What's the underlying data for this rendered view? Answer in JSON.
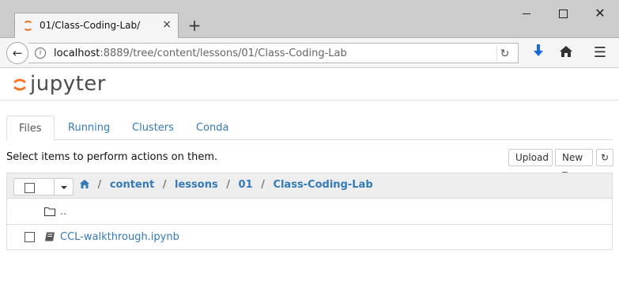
{
  "browser": {
    "tab_title": "01/Class-Coding-Lab/",
    "tab_close": "×",
    "new_tab": "+",
    "url_host": "localhost",
    "url_rest": ":8889/tree/content/lessons/01/Class-Coding-Lab",
    "icons": [
      "info-icon",
      "reload-icon",
      "download-icon",
      "home-icon",
      "menu-icon",
      "back-icon"
    ]
  },
  "app": {
    "logo_text": "jupyter",
    "brand_color": "#f37726",
    "link_color": "#337ab7"
  },
  "tabs": [
    {
      "label": "Files",
      "active": true
    },
    {
      "label": "Running",
      "active": false
    },
    {
      "label": "Clusters",
      "active": false
    },
    {
      "label": "Conda",
      "active": false
    }
  ],
  "toolbar": {
    "hint": "Select items to perform actions on them.",
    "upload_label": "Upload",
    "new_label": "New"
  },
  "breadcrumb": [
    "content",
    "lessons",
    "01",
    "Class-Coding-Lab"
  ],
  "files": [
    {
      "name": "..",
      "type": "folder"
    },
    {
      "name": "CCL-walkthrough.ipynb",
      "type": "notebook"
    }
  ]
}
